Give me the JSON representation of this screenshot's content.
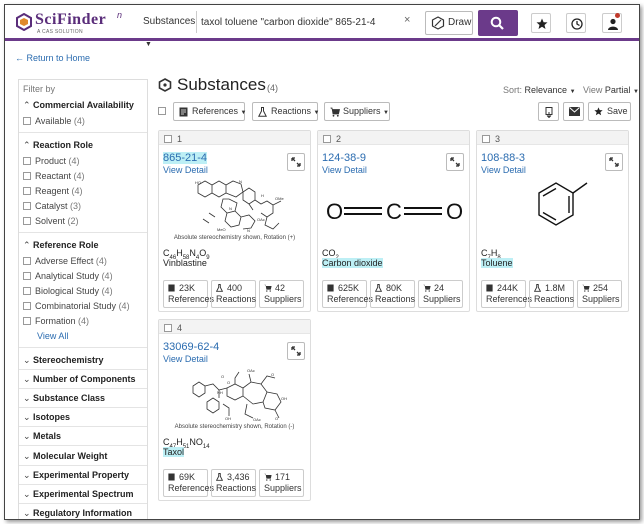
{
  "header": {
    "logo_text": "SciFinder",
    "logo_sup": "n",
    "logo_sub": "A CAS SOLUTION",
    "search_scope": "Substances",
    "search_query": "taxol toluene \"carbon dioxide\" 865-21-4",
    "clear_glyph": "×",
    "draw_label": "Draw",
    "icons": [
      "search-icon",
      "star-icon",
      "history-icon",
      "user-icon"
    ]
  },
  "nav": {
    "back_label": "← Return to Home"
  },
  "page": {
    "title": "Substances",
    "count": "(4)"
  },
  "sort": {
    "sort_label": "Sort:",
    "sort_value": "Relevance",
    "view_label": "View",
    "view_value": "Partial"
  },
  "toolbar": {
    "references": "References",
    "reactions": "Reactions",
    "suppliers": "Suppliers",
    "save": "Save"
  },
  "filters": {
    "title": "Filter by",
    "commercial": {
      "label": "Commercial Availability",
      "options": [
        {
          "name": "Available",
          "count": "(4)"
        }
      ]
    },
    "reaction_role": {
      "label": "Reaction Role",
      "options": [
        {
          "name": "Product",
          "count": "(4)"
        },
        {
          "name": "Reactant",
          "count": "(4)"
        },
        {
          "name": "Reagent",
          "count": "(4)"
        },
        {
          "name": "Catalyst",
          "count": "(3)"
        },
        {
          "name": "Solvent",
          "count": "(2)"
        }
      ]
    },
    "reference_role": {
      "label": "Reference Role",
      "options": [
        {
          "name": "Adverse Effect",
          "count": "(4)"
        },
        {
          "name": "Analytical Study",
          "count": "(4)"
        },
        {
          "name": "Biological Study",
          "count": "(4)"
        },
        {
          "name": "Combinatorial Study",
          "count": "(4)"
        },
        {
          "name": "Formation",
          "count": "(4)"
        }
      ]
    },
    "view_all": "View All",
    "collapsed": [
      "Stereochemistry",
      "Number of Components",
      "Substance Class",
      "Isotopes",
      "Metals",
      "Molecular Weight",
      "Experimental Property",
      "Experimental Spectrum",
      "Regulatory Information"
    ]
  },
  "cards": [
    {
      "num": "1",
      "cas": "865-21-4",
      "view_detail": "View Detail",
      "stereo": "Absolute stereochemistry shown, Rotation (+)",
      "formula_html": "C46H58N4O9",
      "name": "Vinblastine",
      "refs": "23K",
      "rxns": "400",
      "sups": "42",
      "ref_label": "References",
      "rxn_label": "Reactions",
      "sup_label": "Suppliers"
    },
    {
      "num": "2",
      "cas": "124-38-9",
      "view_detail": "View Detail",
      "formula_html": "CO2",
      "name": "Carbon dioxide",
      "refs": "625K",
      "rxns": "80K",
      "sups": "24",
      "ref_label": "References",
      "rxn_label": "Reactions",
      "sup_label": "Suppliers"
    },
    {
      "num": "3",
      "cas": "108-88-3",
      "view_detail": "View Detail",
      "formula_html": "C7H8",
      "name": "Toluene",
      "refs": "244K",
      "rxns": "1.8M",
      "sups": "254",
      "ref_label": "References",
      "rxn_label": "Reactions",
      "sup_label": "Suppliers"
    },
    {
      "num": "4",
      "cas": "33069-62-4",
      "view_detail": "View Detail",
      "stereo": "Absolute stereochemistry shown, Rotation (-)",
      "formula_html": "C47H51NO14",
      "name": "Taxol",
      "refs": "69K",
      "rxns": "3,436",
      "sups": "171",
      "ref_label": "References",
      "rxn_label": "Reactions",
      "sup_label": "Suppliers"
    }
  ],
  "colors": {
    "brand": "#6b3a8a",
    "link": "#2b6cb0",
    "highlight": "#bdeff5"
  }
}
